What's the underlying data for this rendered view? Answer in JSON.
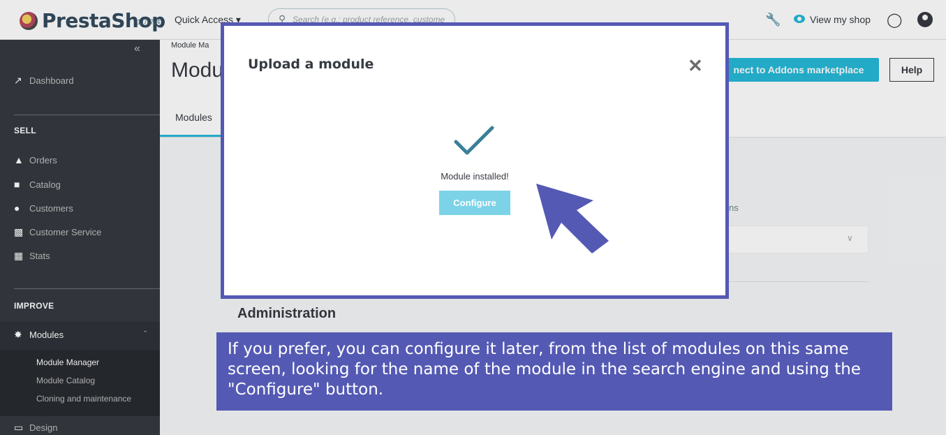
{
  "header": {
    "logo": "PrestaShop",
    "version": "1.7.7.4",
    "quick_access": "Quick Access ▾",
    "search_placeholder": "Search (e.g.: product reference, custome",
    "view_shop": "View my shop"
  },
  "sidebar": {
    "collapse": "«",
    "dashboard": "Dashboard",
    "sell_head": "SELL",
    "sell_items": [
      "Orders",
      "Catalog",
      "Customers",
      "Customer Service",
      "Stats"
    ],
    "improve_head": "IMPROVE",
    "modules": "Modules",
    "sub_items": [
      "Module Manager",
      "Module Catalog",
      "Cloning and maintenance"
    ],
    "design": "Design"
  },
  "page": {
    "breadcrumb": "Module Ma",
    "title": "Modu",
    "addons_button": "nect to Addons marketplace",
    "help_button": "Help",
    "tab": "Modules",
    "bg_fragment": "ns",
    "administration": "Administration"
  },
  "modal": {
    "title": "Upload a module",
    "message": "Module installed!",
    "configure": "Configure"
  },
  "callout": {
    "text": "If you prefer, you can configure it later, from the list of modules on this same screen, looking for the name of the module in the search engine and using the \"Configure\" button."
  },
  "colors": {
    "accent": "#25b9d7",
    "sidebar": "#363a41",
    "highlight": "#5459b4",
    "check": "#3b7f98"
  }
}
